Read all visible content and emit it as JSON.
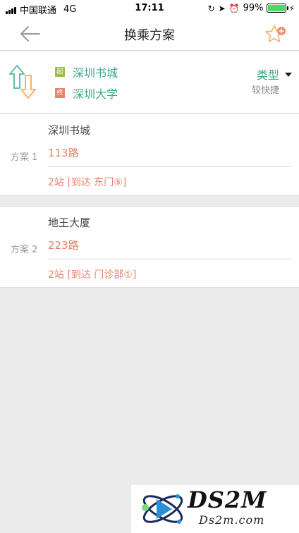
{
  "status_bar": {
    "carrier": "中国联通",
    "network": "4G",
    "time": "17:11",
    "battery": "99%"
  },
  "nav": {
    "title": "换乘方案"
  },
  "route": {
    "start_tag": "起",
    "end_tag": "终",
    "from": "深圳书城",
    "to": "深圳大学",
    "type_label": "类型",
    "type_value": "较快捷"
  },
  "plans": [
    {
      "index": "方案 1",
      "stop": "深圳书城",
      "line": "113路",
      "detail": "2站 [到达 东门⑤]"
    },
    {
      "index": "方案 2",
      "stop": "地王大厦",
      "line": "223路",
      "detail": "2站 [到达 门诊部①]"
    }
  ],
  "watermark": {
    "brand": "DS2M",
    "url": "Ds2m.com"
  },
  "colors": {
    "accent_green": "#3aa88a",
    "accent_orange": "#e7836a",
    "background": "#ebebeb"
  }
}
